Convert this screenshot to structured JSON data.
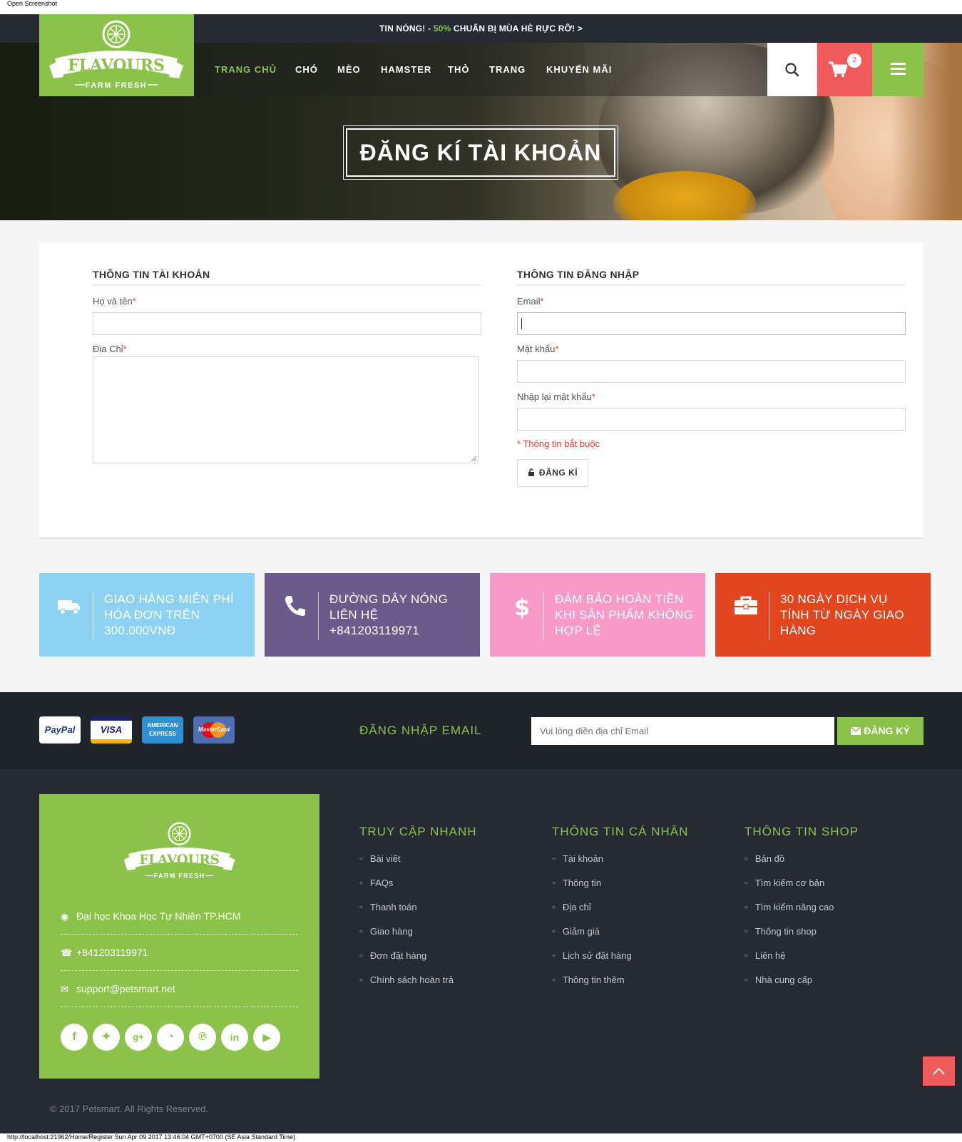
{
  "print": {
    "header": "Open Screenshot",
    "footer": "http://localhost:21962/Home/Register Sun Apr 09 2017 13:46:04 GMT+0700 (SE Asia Standard Time)"
  },
  "topbar": {
    "prefix": "TIN NÓNG! - ",
    "highlight": "50%",
    "suffix": " CHUẨN BỊ MÙA HÈ RỰC RỠ! >"
  },
  "logo": {
    "word": "FLAVOURS",
    "tagline": "FARM FRESH"
  },
  "nav": {
    "items": [
      "TRANG CHỦ",
      "CHÓ",
      "MÈO",
      "HAMSTER",
      "THỎ",
      "TRANG",
      "KHUYẾN MÃI"
    ],
    "active_index": 0,
    "cart_count": "2"
  },
  "hero": {
    "title": "ĐĂNG KÍ TÀI KHOẢN"
  },
  "form": {
    "account": {
      "title": "THÔNG TIN TÀI KHOẢN",
      "name_label": "Họ và tên",
      "address_label": "Địa Chỉ"
    },
    "login": {
      "title": "THÔNG TIN ĐĂNG NHẬP",
      "email_label": "Email",
      "password_label": "Mật khẩu",
      "confirm_label": "Nhập lại mật khẩu",
      "required_note": "* Thông tin bắt buộc",
      "submit": "ĐĂNG KÍ"
    },
    "required_mark": "*"
  },
  "features": [
    {
      "text": "GIAO HÀNG MIỄN PHÍ HÓA ĐƠN TRÊN 300.000VNĐ",
      "color": "#8dd1f3",
      "icon": "truck-icon"
    },
    {
      "text": "ĐƯỜNG DÂY NÓNG LIÊN HỆ +841203119971",
      "color": "#6b5b8b",
      "icon": "phone-icon"
    },
    {
      "text": "ĐẢM BẢO HOÀN TIỀN KHI SẢN PHẨM KHÔNG HỢP LỆ",
      "color": "#f79ac8",
      "icon": "dollar-icon"
    },
    {
      "text": "30 NGÀY DỊCH VỤ TÍNH TỪ NGÀY GIAO HÀNG",
      "color": "#e2461f",
      "icon": "briefcase-icon"
    }
  ],
  "newsletter": {
    "payments": [
      "PayPal",
      "VISA",
      "AMERICAN EXPRESS",
      "MasterCard"
    ],
    "label": "ĐĂNG NHẬP EMAIL",
    "placeholder": "Vui lòng điền địa chỉ Email",
    "button": "ĐĂNG KÝ"
  },
  "footer": {
    "contact": {
      "address": "Đại học Khoa Học Tự Nhiên TP.HCM",
      "phone": "+841203119971",
      "email": "support@petsmart.net"
    },
    "social": [
      "facebook-icon",
      "twitter-icon",
      "google-plus-icon",
      "rss-icon",
      "pinterest-icon",
      "linkedin-icon",
      "youtube-icon"
    ],
    "columns": [
      {
        "title": "TRUY CẬP NHANH",
        "items": [
          "Bài viết",
          "FAQs",
          "Thanh toán",
          "Giao hàng",
          "Đơn đặt hàng",
          "Chính sách hoàn trả"
        ]
      },
      {
        "title": "THÔNG TIN CÁ NHÂN",
        "items": [
          "Tài khoản",
          "Thông tin",
          "Địa chỉ",
          "Giảm giá",
          "Lịch sử đặt hàng",
          "Thông tin thêm"
        ]
      },
      {
        "title": "THÔNG TIN SHOP",
        "items": [
          "Bản đồ",
          "Tìm kiếm cơ bản",
          "Tìm kiếm nâng cao",
          "Thông tin shop",
          "Liên hệ",
          "Nhà cung cấp"
        ]
      }
    ],
    "copyright": "© 2017 Petsmart. All Rights Reserved."
  },
  "colors": {
    "brand_green": "#8bc34a",
    "cart_red": "#ef5b5b",
    "dark": "#262b33"
  }
}
